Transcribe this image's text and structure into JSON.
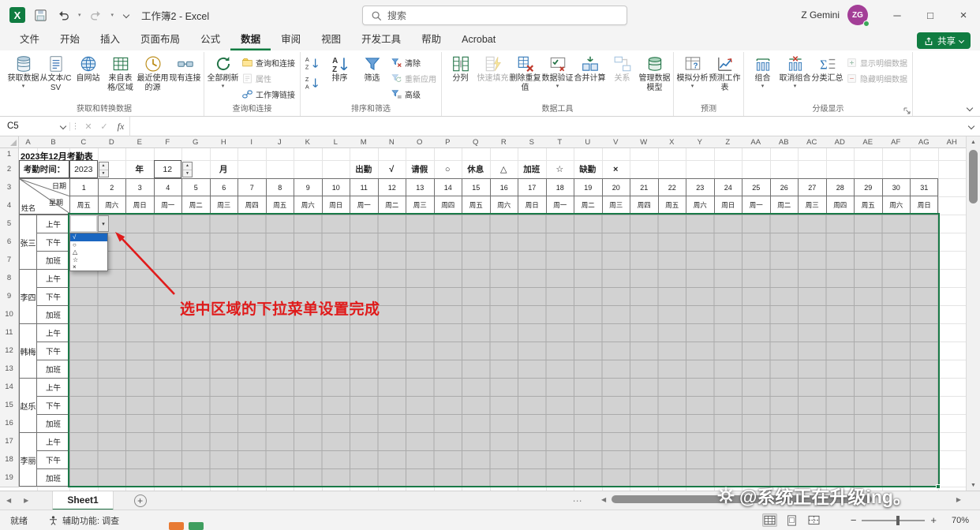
{
  "title_bar": {
    "app_title": "工作簿2 - Excel",
    "search_placeholder": "搜索",
    "user_name": "Z Gemini",
    "user_initials": "ZG"
  },
  "ribbon": {
    "tabs": [
      {
        "key": "file",
        "label": "文件",
        "active": false
      },
      {
        "key": "home",
        "label": "开始",
        "active": false
      },
      {
        "key": "insert",
        "label": "插入",
        "active": false
      },
      {
        "key": "page-layout",
        "label": "页面布局",
        "active": false
      },
      {
        "key": "formulas",
        "label": "公式",
        "active": false
      },
      {
        "key": "data",
        "label": "数据",
        "active": true
      },
      {
        "key": "review",
        "label": "审阅",
        "active": false
      },
      {
        "key": "view",
        "label": "视图",
        "active": false
      },
      {
        "key": "developer",
        "label": "开发工具",
        "active": false
      },
      {
        "key": "help",
        "label": "帮助",
        "active": false
      },
      {
        "key": "acrobat",
        "label": "Acrobat",
        "active": false
      }
    ],
    "share_label": "共享",
    "groups": [
      {
        "key": "get-transform-data",
        "label": "获取和转换数据",
        "items": [
          {
            "type": "large",
            "key": "get-data",
            "label": "获取数据",
            "caret": true
          },
          {
            "type": "large",
            "key": "from-text-csv",
            "label": "从文本/CSV"
          },
          {
            "type": "large",
            "key": "from-web",
            "label": "自网站"
          },
          {
            "type": "large",
            "key": "from-table-range",
            "label": "来自表格/区域"
          },
          {
            "type": "large",
            "key": "recent-sources",
            "label": "最近使用的源"
          },
          {
            "type": "large",
            "key": "existing-connections",
            "label": "现有连接"
          }
        ]
      },
      {
        "key": "queries-connections-group",
        "label": "查询和连接",
        "items": [
          {
            "type": "large",
            "key": "refresh-all",
            "label": "全部刷新",
            "caret": true
          },
          {
            "type": "small-stack",
            "key": "qc-stack",
            "buttons": [
              {
                "key": "queries-connections",
                "label": "查询和连接"
              },
              {
                "key": "properties",
                "label": "属性",
                "disabled": true
              },
              {
                "key": "workbook-links",
                "label": "工作簿链接"
              }
            ]
          }
        ]
      },
      {
        "key": "sort-filter",
        "label": "排序和筛选",
        "items": [
          {
            "type": "icon-stack",
            "key": "sort-stack",
            "buttons": [
              {
                "key": "sort-ascending",
                "label": "升序"
              },
              {
                "key": "sort-descending",
                "label": "降序"
              }
            ]
          },
          {
            "type": "large",
            "key": "sort",
            "label": "排序"
          },
          {
            "type": "large",
            "key": "filter",
            "label": "筛选"
          },
          {
            "type": "small-stack",
            "key": "filter-stack",
            "buttons": [
              {
                "key": "clear-filter",
                "label": "清除"
              },
              {
                "key": "reapply-filter",
                "label": "重新应用",
                "disabled": true
              },
              {
                "key": "advanced-filter",
                "label": "高级"
              }
            ]
          }
        ]
      },
      {
        "key": "data-tools",
        "label": "数据工具",
        "items": [
          {
            "type": "large",
            "key": "text-to-columns",
            "label": "分列"
          },
          {
            "type": "large",
            "key": "flash-fill",
            "label": "快速填充",
            "disabled": true
          },
          {
            "type": "large",
            "key": "remove-duplicates",
            "label": "删除重复值"
          },
          {
            "type": "large",
            "key": "data-validation",
            "label": "数据验证",
            "caret": true
          },
          {
            "type": "large",
            "key": "consolidate",
            "label": "合并计算"
          },
          {
            "type": "large",
            "key": "relationships",
            "label": "关系",
            "disabled": true
          },
          {
            "type": "large",
            "key": "manage-data-model",
            "label": "管理数据模型"
          }
        ]
      },
      {
        "key": "forecast",
        "label": "预测",
        "items": [
          {
            "type": "large",
            "key": "what-if-analysis",
            "label": "模拟分析",
            "caret": true
          },
          {
            "type": "large",
            "key": "forecast-sheet",
            "label": "预测工作表"
          }
        ]
      },
      {
        "key": "outline",
        "label": "分级显示",
        "dialog_launcher": true,
        "items": [
          {
            "type": "large",
            "key": "group",
            "label": "组合",
            "caret": true
          },
          {
            "type": "large",
            "key": "ungroup",
            "label": "取消组合",
            "caret": true
          },
          {
            "type": "large",
            "key": "subtotal",
            "label": "分类汇总"
          },
          {
            "type": "small-stack",
            "key": "detail-stack",
            "buttons": [
              {
                "key": "show-detail",
                "label": "显示明细数据",
                "disabled": true
              },
              {
                "key": "hide-detail",
                "label": "隐藏明细数据",
                "disabled": true
              }
            ]
          }
        ]
      }
    ]
  },
  "formula_bar": {
    "name_box": "C5",
    "fx_label": "fx",
    "formula_value": ""
  },
  "sheet": {
    "column_headers": [
      "A",
      "B",
      "C",
      "D",
      "E",
      "F",
      "G",
      "H",
      "I",
      "J",
      "K",
      "L",
      "M",
      "N",
      "O",
      "P",
      "Q",
      "R",
      "S",
      "T",
      "U",
      "V",
      "W",
      "X",
      "Y",
      "Z",
      "AA",
      "AB",
      "AC",
      "AD",
      "AE",
      "AF",
      "AG",
      "AH"
    ],
    "visible_rows": 19,
    "cells": {
      "a1_title": "2023年12月考勤表",
      "attendance_label": "考勤时间：",
      "year": "2023",
      "year_unit": "年",
      "month": "12",
      "month_unit": "月",
      "legend": [
        {
          "name": "出勤",
          "mark": "√"
        },
        {
          "name": "请假",
          "mark": "○"
        },
        {
          "name": "休息",
          "mark": "△"
        },
        {
          "name": "加班",
          "mark": "☆"
        },
        {
          "name": "缺勤",
          "mark": "×"
        }
      ],
      "corner": {
        "date": "日期",
        "week": "星期",
        "name": "姓名"
      },
      "dates": [
        "1",
        "2",
        "3",
        "4",
        "5",
        "6",
        "7",
        "8",
        "9",
        "10",
        "11",
        "12",
        "13",
        "14",
        "15",
        "16",
        "17",
        "18",
        "19",
        "20",
        "21",
        "22",
        "23",
        "24",
        "25",
        "26",
        "27",
        "28",
        "29",
        "30",
        "31"
      ],
      "weekdays": [
        "周五",
        "周六",
        "周日",
        "周一",
        "周二",
        "周三",
        "周四",
        "周五",
        "周六",
        "周日",
        "周一",
        "周二",
        "周三",
        "周四",
        "周五",
        "周六",
        "周日",
        "周一",
        "周二",
        "周三",
        "周四",
        "周五",
        "周六",
        "周日",
        "周一",
        "周二",
        "周三",
        "周四",
        "周五",
        "周六",
        "周日"
      ],
      "employees": [
        "张三",
        "李四",
        "韩梅",
        "赵乐",
        "李丽"
      ],
      "shift_labels": [
        "上午",
        "下午",
        "加班"
      ]
    },
    "active_cell": "C5",
    "dropdown_options": [
      "√",
      "○",
      "△",
      "☆",
      "×"
    ],
    "dropdown_selected_index": 0
  },
  "annotation": {
    "text": "选中区域的下拉菜单设置完成"
  },
  "sheet_bar": {
    "tab": "Sheet1"
  },
  "status_bar": {
    "ready": "就绪",
    "accessibility": "辅助功能: 调查",
    "zoom": "70%"
  },
  "watermark": "@系统正在升级ing。",
  "colors": {
    "accent_green": "#107c41",
    "selection_gray": "#d2d2d2",
    "dropdown_highlight_blue": "#1a66c0",
    "annotation_red": "#e01b1b"
  }
}
